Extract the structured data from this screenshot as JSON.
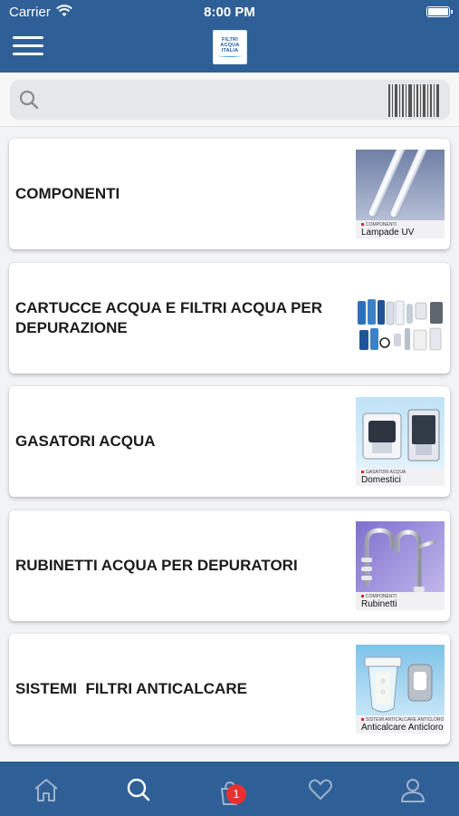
{
  "status_bar": {
    "carrier": "Carrier",
    "time": "8:00 PM"
  },
  "header": {
    "logo": {
      "line1": "FILTRI",
      "line2": "ACQUA",
      "line3": "ITALIA"
    },
    "icons": {
      "menu": "hamburger-icon"
    }
  },
  "search": {
    "value": "",
    "placeholder": "",
    "icons": [
      "search-icon",
      "barcode-scanner-icon"
    ]
  },
  "categories": [
    {
      "title": "COMPONENTI",
      "image": {
        "tag": "COMPONENTI",
        "caption": "Lampade UV",
        "theme": "uv-lamps"
      }
    },
    {
      "title": "CARTUCCE ACQUA E FILTRI ACQUA PER\nDEPURAZIONE",
      "image": {
        "tag": "",
        "caption": "",
        "theme": "filter-cartridges"
      }
    },
    {
      "title": "GASATORI ACQUA",
      "image": {
        "tag": "GASATORI ACQUA",
        "caption": "Domestici",
        "theme": "carbonators"
      }
    },
    {
      "title": "RUBINETTI ACQUA PER DEPURATORI",
      "image": {
        "tag": "COMPONENTI",
        "caption": "Rubinetti",
        "theme": "faucets"
      }
    },
    {
      "title": "SISTEMI  FILTRI ANTICALCARE",
      "image": {
        "tag": "SISTEMI ANTICALCARE ANTICLORO",
        "caption": "Anticalcare Anticloro",
        "theme": "anti-scale"
      }
    }
  ],
  "tabbar": {
    "tabs": [
      "home-icon",
      "search-icon",
      "cart-icon",
      "heart-icon",
      "user-icon"
    ],
    "active_tab": "search-icon",
    "cart_badge": "1"
  },
  "colors": {
    "brand_blue": "#2f5f97",
    "badge_red": "#e8302d"
  }
}
